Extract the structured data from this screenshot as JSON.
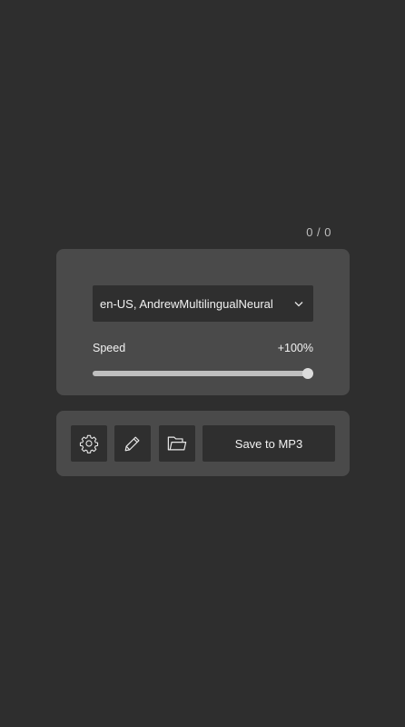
{
  "progress": {
    "counter": "0 / 0"
  },
  "voice": {
    "selected": "en-US, AndrewMultilingualNeural"
  },
  "speed": {
    "label": "Speed",
    "value_text": "+100%",
    "slider_fraction": 1.0
  },
  "actions": {
    "settings_icon": "gear-icon",
    "edit_icon": "pencil-icon",
    "open_icon": "folder-icon",
    "save_label": "Save to MP3"
  },
  "colors": {
    "background": "#2e2e2e",
    "panel": "#4a4a4a",
    "control": "#2f2f2f",
    "text": "#f2f2f2"
  }
}
